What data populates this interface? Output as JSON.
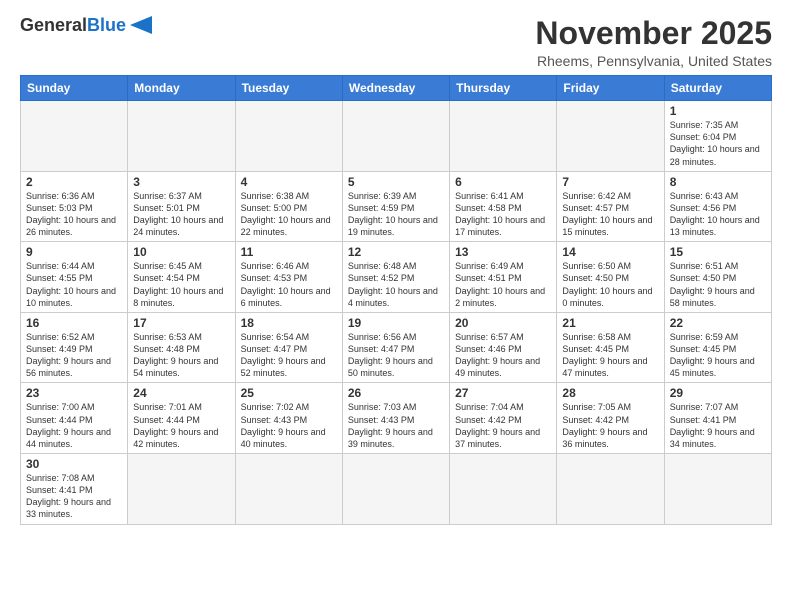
{
  "logo": {
    "text_general": "General",
    "text_blue": "Blue"
  },
  "title": "November 2025",
  "subtitle": "Rheems, Pennsylvania, United States",
  "days_of_week": [
    "Sunday",
    "Monday",
    "Tuesday",
    "Wednesday",
    "Thursday",
    "Friday",
    "Saturday"
  ],
  "weeks": [
    [
      {
        "day": "",
        "empty": true
      },
      {
        "day": "",
        "empty": true
      },
      {
        "day": "",
        "empty": true
      },
      {
        "day": "",
        "empty": true
      },
      {
        "day": "",
        "empty": true
      },
      {
        "day": "",
        "empty": true
      },
      {
        "day": "1",
        "info": "Sunrise: 7:35 AM\nSunset: 6:04 PM\nDaylight: 10 hours and 28 minutes."
      }
    ],
    [
      {
        "day": "2",
        "info": "Sunrise: 6:36 AM\nSunset: 5:03 PM\nDaylight: 10 hours and 26 minutes."
      },
      {
        "day": "3",
        "info": "Sunrise: 6:37 AM\nSunset: 5:01 PM\nDaylight: 10 hours and 24 minutes."
      },
      {
        "day": "4",
        "info": "Sunrise: 6:38 AM\nSunset: 5:00 PM\nDaylight: 10 hours and 22 minutes."
      },
      {
        "day": "5",
        "info": "Sunrise: 6:39 AM\nSunset: 4:59 PM\nDaylight: 10 hours and 19 minutes."
      },
      {
        "day": "6",
        "info": "Sunrise: 6:41 AM\nSunset: 4:58 PM\nDaylight: 10 hours and 17 minutes."
      },
      {
        "day": "7",
        "info": "Sunrise: 6:42 AM\nSunset: 4:57 PM\nDaylight: 10 hours and 15 minutes."
      },
      {
        "day": "8",
        "info": "Sunrise: 6:43 AM\nSunset: 4:56 PM\nDaylight: 10 hours and 13 minutes."
      }
    ],
    [
      {
        "day": "9",
        "info": "Sunrise: 6:44 AM\nSunset: 4:55 PM\nDaylight: 10 hours and 10 minutes."
      },
      {
        "day": "10",
        "info": "Sunrise: 6:45 AM\nSunset: 4:54 PM\nDaylight: 10 hours and 8 minutes."
      },
      {
        "day": "11",
        "info": "Sunrise: 6:46 AM\nSunset: 4:53 PM\nDaylight: 10 hours and 6 minutes."
      },
      {
        "day": "12",
        "info": "Sunrise: 6:48 AM\nSunset: 4:52 PM\nDaylight: 10 hours and 4 minutes."
      },
      {
        "day": "13",
        "info": "Sunrise: 6:49 AM\nSunset: 4:51 PM\nDaylight: 10 hours and 2 minutes."
      },
      {
        "day": "14",
        "info": "Sunrise: 6:50 AM\nSunset: 4:50 PM\nDaylight: 10 hours and 0 minutes."
      },
      {
        "day": "15",
        "info": "Sunrise: 6:51 AM\nSunset: 4:50 PM\nDaylight: 9 hours and 58 minutes."
      }
    ],
    [
      {
        "day": "16",
        "info": "Sunrise: 6:52 AM\nSunset: 4:49 PM\nDaylight: 9 hours and 56 minutes."
      },
      {
        "day": "17",
        "info": "Sunrise: 6:53 AM\nSunset: 4:48 PM\nDaylight: 9 hours and 54 minutes."
      },
      {
        "day": "18",
        "info": "Sunrise: 6:54 AM\nSunset: 4:47 PM\nDaylight: 9 hours and 52 minutes."
      },
      {
        "day": "19",
        "info": "Sunrise: 6:56 AM\nSunset: 4:47 PM\nDaylight: 9 hours and 50 minutes."
      },
      {
        "day": "20",
        "info": "Sunrise: 6:57 AM\nSunset: 4:46 PM\nDaylight: 9 hours and 49 minutes."
      },
      {
        "day": "21",
        "info": "Sunrise: 6:58 AM\nSunset: 4:45 PM\nDaylight: 9 hours and 47 minutes."
      },
      {
        "day": "22",
        "info": "Sunrise: 6:59 AM\nSunset: 4:45 PM\nDaylight: 9 hours and 45 minutes."
      }
    ],
    [
      {
        "day": "23",
        "info": "Sunrise: 7:00 AM\nSunset: 4:44 PM\nDaylight: 9 hours and 44 minutes."
      },
      {
        "day": "24",
        "info": "Sunrise: 7:01 AM\nSunset: 4:44 PM\nDaylight: 9 hours and 42 minutes."
      },
      {
        "day": "25",
        "info": "Sunrise: 7:02 AM\nSunset: 4:43 PM\nDaylight: 9 hours and 40 minutes."
      },
      {
        "day": "26",
        "info": "Sunrise: 7:03 AM\nSunset: 4:43 PM\nDaylight: 9 hours and 39 minutes."
      },
      {
        "day": "27",
        "info": "Sunrise: 7:04 AM\nSunset: 4:42 PM\nDaylight: 9 hours and 37 minutes."
      },
      {
        "day": "28",
        "info": "Sunrise: 7:05 AM\nSunset: 4:42 PM\nDaylight: 9 hours and 36 minutes."
      },
      {
        "day": "29",
        "info": "Sunrise: 7:07 AM\nSunset: 4:41 PM\nDaylight: 9 hours and 34 minutes."
      }
    ],
    [
      {
        "day": "30",
        "info": "Sunrise: 7:08 AM\nSunset: 4:41 PM\nDaylight: 9 hours and 33 minutes."
      },
      {
        "day": "",
        "empty": true
      },
      {
        "day": "",
        "empty": true
      },
      {
        "day": "",
        "empty": true
      },
      {
        "day": "",
        "empty": true
      },
      {
        "day": "",
        "empty": true
      },
      {
        "day": "",
        "empty": true
      }
    ]
  ]
}
